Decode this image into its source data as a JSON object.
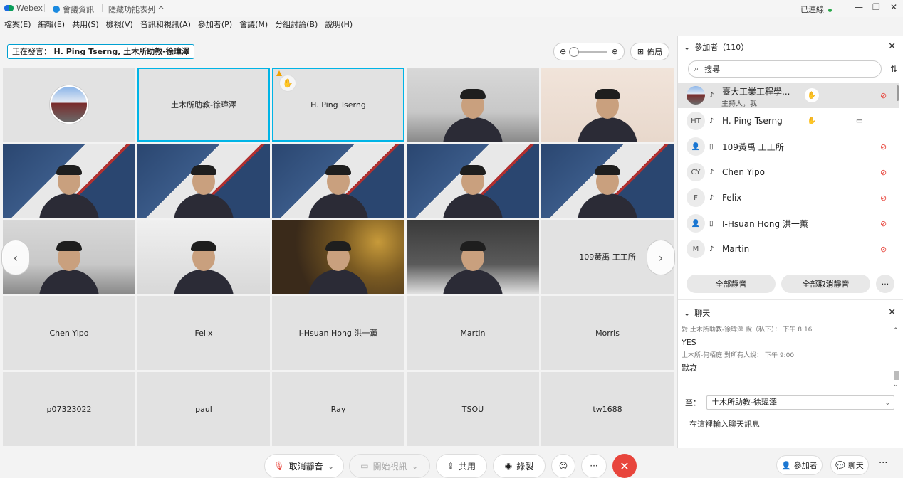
{
  "titlebar": {
    "app_name": "Webex",
    "meeting_info": "會議資訊",
    "hidden_menu": "隱藏功能表列 ^",
    "connection": "已連線"
  },
  "menu": [
    "檔案(E)",
    "編輯(E)",
    "共用(S)",
    "檢視(V)",
    "音訊和視訊(A)",
    "參加者(P)",
    "會議(M)",
    "分組討論(B)",
    "說明(H)"
  ],
  "speaking": {
    "label": "正在發言：",
    "names": "H. Ping Tserng, 土木所助教-徐瑋澤"
  },
  "layout_button": "佈局",
  "tiles": [
    {
      "name": "",
      "kind": "avatar"
    },
    {
      "name": "土木所助教-徐瑋澤",
      "kind": "name",
      "active": true
    },
    {
      "name": "H. Ping Tserng",
      "kind": "name",
      "active": true,
      "hand": true
    },
    {
      "name": "",
      "kind": "video",
      "bg": "bg-office"
    },
    {
      "name": "",
      "kind": "video",
      "bg": "bg-room"
    },
    {
      "name": "",
      "kind": "video",
      "bg": "bg-btc"
    },
    {
      "name": "",
      "kind": "video",
      "bg": "bg-btc"
    },
    {
      "name": "",
      "kind": "video",
      "bg": "bg-btc"
    },
    {
      "name": "",
      "kind": "video",
      "bg": "bg-btc"
    },
    {
      "name": "",
      "kind": "video",
      "bg": "bg-btc"
    },
    {
      "name": "",
      "kind": "video",
      "bg": "bg-office"
    },
    {
      "name": "",
      "kind": "video",
      "bg": "bg-gray"
    },
    {
      "name": "",
      "kind": "video",
      "bg": "bg-coin"
    },
    {
      "name": "",
      "kind": "video",
      "bg": "bg-map"
    },
    {
      "name": "109黃禹 工工所",
      "kind": "name"
    },
    {
      "name": "Chen Yipo",
      "kind": "name"
    },
    {
      "name": "Felix",
      "kind": "name"
    },
    {
      "name": "I-Hsuan Hong 洪一薰",
      "kind": "name"
    },
    {
      "name": "Martin",
      "kind": "name"
    },
    {
      "name": "Morris",
      "kind": "name"
    },
    {
      "name": "p07323022",
      "kind": "name"
    },
    {
      "name": "paul",
      "kind": "name"
    },
    {
      "name": "Ray",
      "kind": "name"
    },
    {
      "name": "TSOU",
      "kind": "name"
    },
    {
      "name": "tw1688",
      "kind": "name"
    }
  ],
  "toolbar": {
    "unmute": "取消靜音",
    "start_video": "開始視訊",
    "share": "共用",
    "record": "錄製",
    "more": "···",
    "participants": "參加者",
    "chat": "聊天"
  },
  "participants_panel": {
    "title": "參加者（110）",
    "search_placeholder": "搜尋",
    "rows": [
      {
        "initials": "",
        "name": "臺大工業工程學...",
        "sub": "主持人，我",
        "host": true,
        "hand": true,
        "muted": true
      },
      {
        "initials": "HT",
        "name": "H. Ping Tserng",
        "hand": true,
        "video": true,
        "muted": false
      },
      {
        "initials": "",
        "name": "109黃禹 工工所",
        "muted": true,
        "device": "phone"
      },
      {
        "initials": "CY",
        "name": "Chen Yipo",
        "muted": true
      },
      {
        "initials": "F",
        "name": "Felix",
        "muted": true
      },
      {
        "initials": "",
        "name": "I-Hsuan Hong 洪一薰",
        "muted": true,
        "device": "phone"
      },
      {
        "initials": "M",
        "name": "Martin",
        "muted": true
      }
    ],
    "mute_all": "全部靜音",
    "unmute_all": "全部取消靜音"
  },
  "chat_panel": {
    "title": "聊天",
    "messages": [
      {
        "meta": "對 土木所助教-徐瑋澤 說（私下）：   下午 8:16",
        "text": "YES"
      },
      {
        "meta": "土木所-何栢庭 對所有人說：   下午 9:00",
        "text": "默哀"
      }
    ],
    "to_label": "至：",
    "to_value": "土木所助教-徐瑋澤",
    "input_placeholder": "在這裡輸入聊天訊息"
  }
}
